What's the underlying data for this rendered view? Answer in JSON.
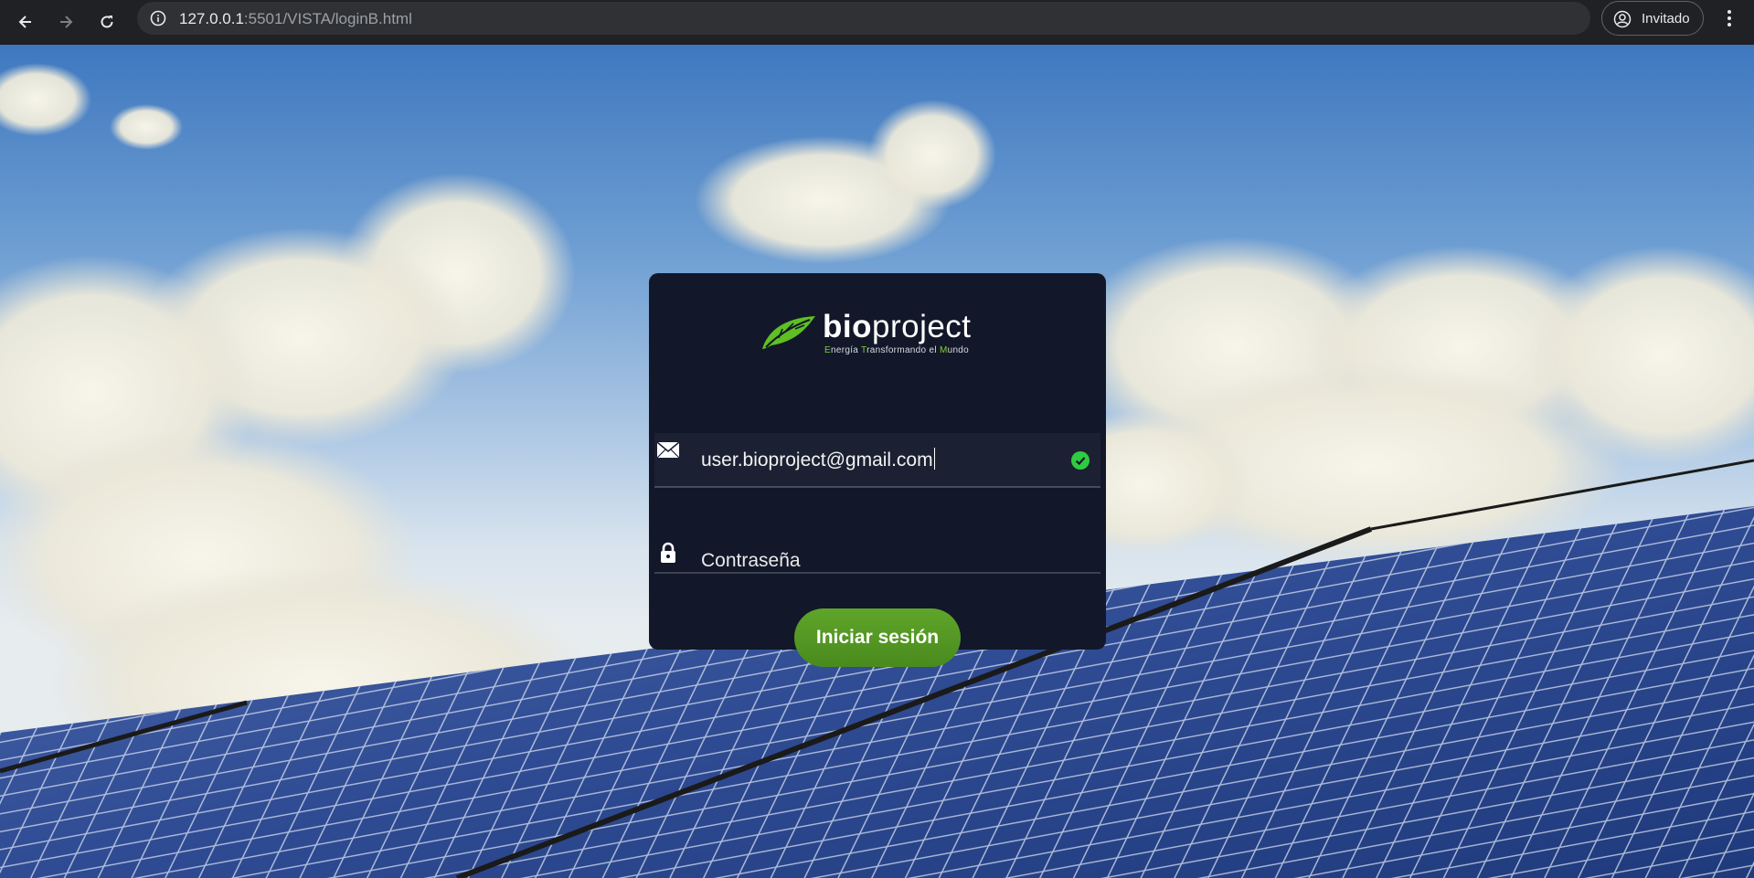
{
  "browser": {
    "url_host": "127.0.0.1",
    "url_rest": ":5501/VISTA/loginB.html",
    "profile_label": "Invitado"
  },
  "login": {
    "brand_bold": "bio",
    "brand_light": "project",
    "tagline": {
      "e": "E",
      "rest1": "nergía ",
      "t": "T",
      "rest2": "ransformando el ",
      "m": "M",
      "rest3": "undo"
    },
    "email_value": "user.bioproject@gmail.com",
    "password_placeholder": "Contraseña",
    "submit_label": "Iniciar sesión"
  },
  "colors": {
    "card": "#121829",
    "accent_green": "#4a8a1e",
    "valid_check": "#2ecc40"
  }
}
